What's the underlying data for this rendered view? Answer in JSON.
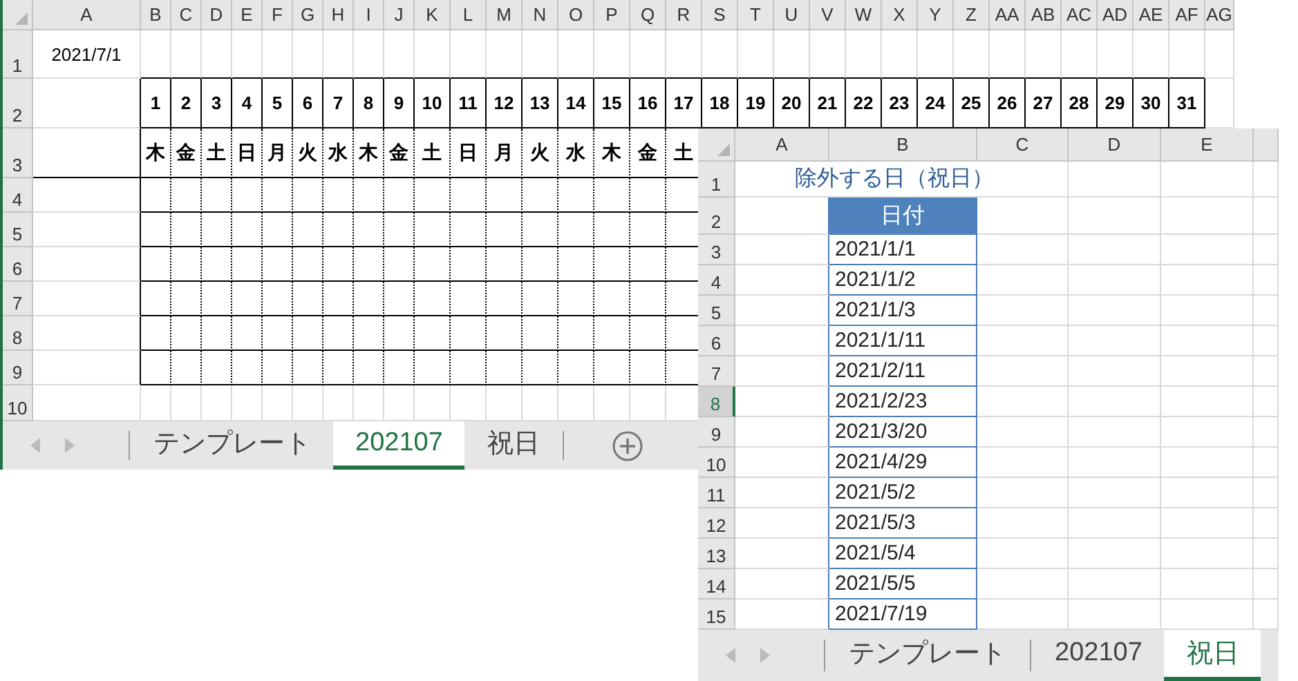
{
  "window_1": {
    "column_headers": [
      "A",
      "B",
      "C",
      "D",
      "E",
      "F",
      "G",
      "H",
      "I",
      "J",
      "K",
      "L",
      "M",
      "N",
      "O",
      "P",
      "Q",
      "R",
      "S",
      "T",
      "U",
      "V",
      "W",
      "X",
      "Y",
      "Z",
      "AA",
      "AB",
      "AC",
      "AD",
      "AE",
      "AF",
      "AG"
    ],
    "row_headers": [
      "1",
      "2",
      "3",
      "4",
      "5",
      "6",
      "7",
      "8",
      "9",
      "10"
    ],
    "cell_a1": "2021/7/1",
    "days": [
      "1",
      "2",
      "3",
      "4",
      "5",
      "6",
      "7",
      "8",
      "9",
      "10",
      "11",
      "12",
      "13",
      "14",
      "15",
      "16",
      "17",
      "18",
      "19",
      "20",
      "21",
      "22",
      "23",
      "24",
      "25",
      "26",
      "27",
      "28",
      "29",
      "30",
      "31"
    ],
    "weekdays": [
      "木",
      "金",
      "土",
      "日",
      "月",
      "火",
      "水",
      "木",
      "金",
      "土",
      "日",
      "月",
      "火",
      "水",
      "木",
      "金",
      "土"
    ],
    "tabs": [
      {
        "label": "テンプレート",
        "selected": false
      },
      {
        "label": "202107",
        "selected": true
      },
      {
        "label": "祝日",
        "selected": false
      }
    ],
    "add_sheet": true
  },
  "window_2": {
    "column_headers": [
      "A",
      "B",
      "C",
      "D",
      "E"
    ],
    "row_headers": [
      {
        "label": "1",
        "selected": false
      },
      {
        "label": "2",
        "selected": false
      },
      {
        "label": "3",
        "selected": false
      },
      {
        "label": "4",
        "selected": false
      },
      {
        "label": "5",
        "selected": false
      },
      {
        "label": "6",
        "selected": false
      },
      {
        "label": "7",
        "selected": false
      },
      {
        "label": "8",
        "selected": true
      },
      {
        "label": "9",
        "selected": false
      },
      {
        "label": "10",
        "selected": false
      },
      {
        "label": "11",
        "selected": false
      },
      {
        "label": "12",
        "selected": false
      },
      {
        "label": "13",
        "selected": false
      },
      {
        "label": "14",
        "selected": false
      },
      {
        "label": "15",
        "selected": false
      }
    ],
    "title": "除外する日（祝日）",
    "table_header": "日付",
    "dates": [
      "2021/1/1",
      "2021/1/2",
      "2021/1/3",
      "2021/1/11",
      "2021/2/11",
      "2021/2/23",
      "2021/3/20",
      "2021/4/29",
      "2021/5/2",
      "2021/5/3",
      "2021/5/4",
      "2021/5/5",
      "2021/7/19"
    ],
    "tabs": [
      {
        "label": "テンプレート",
        "selected": false
      },
      {
        "label": "202107",
        "selected": false
      },
      {
        "label": "祝日",
        "selected": true
      }
    ]
  }
}
